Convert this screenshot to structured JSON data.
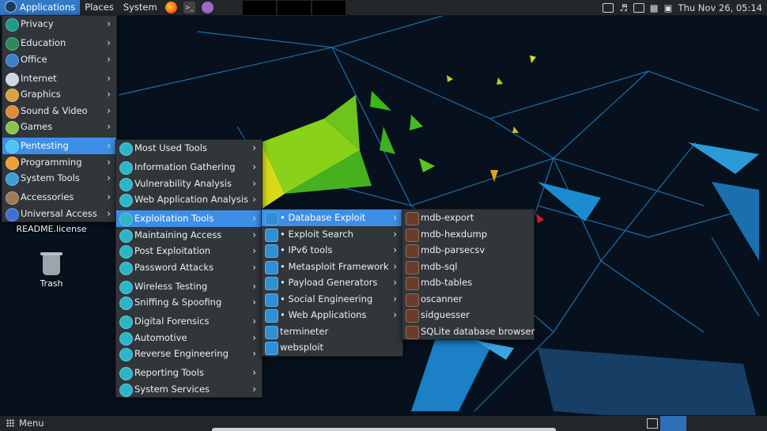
{
  "top_panel": {
    "menus": [
      "Applications",
      "Places",
      "System"
    ],
    "clock": "Thu Nov 26, 05:14"
  },
  "bottom_panel": {
    "menu_label": "Menu"
  },
  "desktop": {
    "readme_label": "README.license",
    "trash_label": "Trash"
  },
  "categories_menu": [
    {
      "label": "Privacy",
      "icon": "privacy-icon",
      "color": "#1f9a8a"
    },
    {
      "label": "Education",
      "icon": "education-icon",
      "color": "#2a8c5a"
    },
    {
      "label": "Office",
      "icon": "office-icon",
      "color": "#3a7fd0"
    },
    {
      "label": "Internet",
      "icon": "internet-icon",
      "color": "#cfd8e0"
    },
    {
      "label": "Graphics",
      "icon": "graphics-icon",
      "color": "#d9a441"
    },
    {
      "label": "Sound & Video",
      "icon": "sound-video-icon",
      "color": "#e08a3c"
    },
    {
      "label": "Games",
      "icon": "games-icon",
      "color": "#8bc34a"
    },
    {
      "label": "Pentesting",
      "icon": "pentesting-icon",
      "color": "#4fc3f7"
    },
    {
      "label": "Programming",
      "icon": "programming-icon",
      "color": "#f0a030"
    },
    {
      "label": "System Tools",
      "icon": "system-tools-icon",
      "color": "#3aa0d8"
    },
    {
      "label": "Accessories",
      "icon": "accessories-icon",
      "color": "#9c7b55"
    },
    {
      "label": "Universal Access",
      "icon": "universal-access-icon",
      "color": "#3f6fd1"
    }
  ],
  "pentest_menu": [
    {
      "label": "Most Used Tools",
      "icon": "most-used-tools-icon"
    },
    {
      "label": "Information Gathering",
      "icon": "information-gathering-icon"
    },
    {
      "label": "Vulnerability Analysis",
      "icon": "vulnerability-analysis-icon"
    },
    {
      "label": "Web Application Analysis",
      "icon": "web-application-analysis-icon"
    },
    {
      "label": "Exploitation Tools",
      "icon": "exploitation-tools-icon"
    },
    {
      "label": "Maintaining Access",
      "icon": "maintaining-access-icon"
    },
    {
      "label": "Post Exploitation",
      "icon": "post-exploitation-icon"
    },
    {
      "label": "Password Attacks",
      "icon": "password-attacks-icon"
    },
    {
      "label": "Wireless Testing",
      "icon": "wireless-testing-icon"
    },
    {
      "label": "Sniffing & Spoofing",
      "icon": "sniffing-spoofing-icon"
    },
    {
      "label": "Digital Forensics",
      "icon": "digital-forensics-icon"
    },
    {
      "label": "Automotive",
      "icon": "automotive-icon"
    },
    {
      "label": "Reverse Engineering",
      "icon": "reverse-engineering-icon"
    },
    {
      "label": "Reporting Tools",
      "icon": "reporting-tools-icon"
    },
    {
      "label": "System Services",
      "icon": "system-services-icon"
    }
  ],
  "exploit_menu": [
    {
      "label": "• Database Exploit",
      "icon": "database-exploit-icon"
    },
    {
      "label": "• Exploit Search",
      "icon": "exploit-search-icon"
    },
    {
      "label": "• IPv6 tools",
      "icon": "ipv6-tools-icon"
    },
    {
      "label": "• Metasploit Framework",
      "icon": "metasploit-icon"
    },
    {
      "label": "• Payload Generators",
      "icon": "payload-generators-icon"
    },
    {
      "label": "• Social Engineering",
      "icon": "social-engineering-icon"
    },
    {
      "label": "• Web Applications",
      "icon": "web-applications-icon"
    },
    {
      "label": "termineter",
      "icon": "termineter-icon"
    },
    {
      "label": "websploit",
      "icon": "websploit-icon"
    }
  ],
  "database_menu": [
    {
      "label": "mdb-export",
      "icon": "mdb-export-icon"
    },
    {
      "label": "mdb-hexdump",
      "icon": "mdb-hexdump-icon"
    },
    {
      "label": "mdb-parsecsv",
      "icon": "mdb-parsecsv-icon"
    },
    {
      "label": "mdb-sql",
      "icon": "mdb-sql-icon"
    },
    {
      "label": "mdb-tables",
      "icon": "mdb-tables-icon"
    },
    {
      "label": "oscanner",
      "icon": "oscanner-icon"
    },
    {
      "label": "sidguesser",
      "icon": "sidguesser-icon"
    },
    {
      "label": "SQLite database browser",
      "icon": "sqlite-browser-icon"
    }
  ]
}
